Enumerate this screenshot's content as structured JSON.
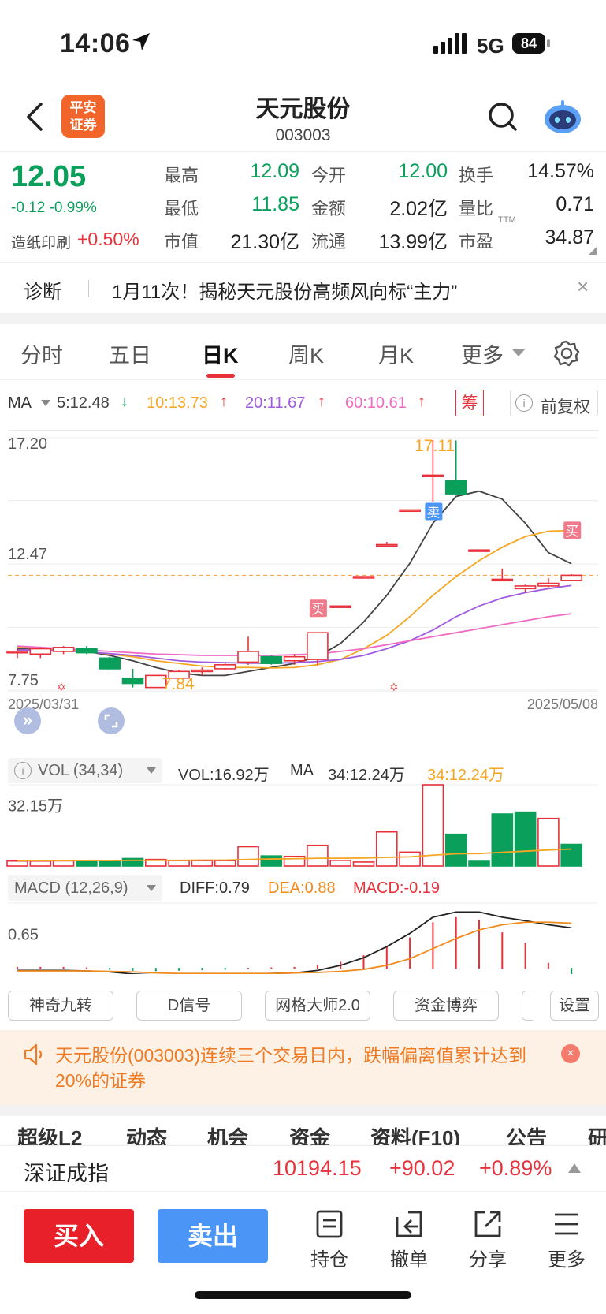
{
  "status": {
    "time": "14:06",
    "network": "5G",
    "battery": "84"
  },
  "header": {
    "broker_logo_line1": "平安",
    "broker_logo_line2": "证券",
    "stock_name": "天元股份",
    "stock_code": "003003"
  },
  "quote": {
    "price": "12.05",
    "change": "-0.12 -0.99%",
    "sector_name": "造纸印刷",
    "sector_change": "+0.50%",
    "fields": [
      {
        "label": "最高",
        "value": "12.09",
        "color": "green"
      },
      {
        "label": "今开",
        "value": "12.00",
        "color": "green"
      },
      {
        "label": "换手",
        "value": "14.57%",
        "color": "black"
      },
      {
        "label": "最低",
        "value": "11.85",
        "color": "green"
      },
      {
        "label": "金额",
        "value": "2.02亿",
        "color": "black"
      },
      {
        "label": "量比",
        "value": "0.71",
        "color": "black"
      },
      {
        "label": "市值",
        "value": "21.30亿",
        "color": "black"
      },
      {
        "label": "流通",
        "value": "13.99亿",
        "color": "black"
      },
      {
        "label": "市盈",
        "value": "34.87",
        "color": "black",
        "superscript": "TTM"
      }
    ]
  },
  "notice": {
    "label": "诊断",
    "text": "1月11次！揭秘天元股份高频风向标“主力”",
    "close": "×"
  },
  "tabs": [
    {
      "label": "分时",
      "active": false
    },
    {
      "label": "五日",
      "active": false
    },
    {
      "label": "日K",
      "active": true
    },
    {
      "label": "周K",
      "active": false
    },
    {
      "label": "月K",
      "active": false
    },
    {
      "label": "更多",
      "active": false
    }
  ],
  "ma_row": {
    "label": "MA",
    "ma5": "5:12.48",
    "ma10": "10:13.73",
    "ma20": "20:11.67",
    "ma60": "60:10.61",
    "chip_button": "筹",
    "adjust": "前复权",
    "colors": {
      "ma5": "#444444",
      "ma10": "#f5a623",
      "ma20": "#a05be0",
      "ma60": "#f06ac4"
    }
  },
  "chart_data": [
    {
      "type": "candlestick",
      "title": "",
      "y_labels": [
        "17.20",
        "12.47",
        "7.75"
      ],
      "ylim": [
        7.75,
        17.2
      ],
      "date_start": "2025/03/31",
      "date_end": "2025/05/08",
      "max_label": "17.11",
      "min_label": "7.84",
      "signals": [
        {
          "label": "买",
          "at": "candle 13"
        },
        {
          "label": "卖",
          "at": "candle 18"
        },
        {
          "label": "买",
          "at": "candle 24"
        }
      ],
      "candles": [
        {
          "o": 9.2,
          "h": 9.3,
          "l": 8.95,
          "c": 9.2
        },
        {
          "o": 9.1,
          "h": 9.35,
          "l": 8.95,
          "c": 9.3
        },
        {
          "o": 9.2,
          "h": 9.4,
          "l": 9.1,
          "c": 9.35
        },
        {
          "o": 9.3,
          "h": 9.4,
          "l": 9.1,
          "c": 9.15
        },
        {
          "o": 8.95,
          "h": 9.0,
          "l": 8.5,
          "c": 8.55
        },
        {
          "o": 8.2,
          "h": 8.55,
          "l": 7.85,
          "c": 8.0
        },
        {
          "o": 7.85,
          "h": 8.3,
          "l": 7.84,
          "c": 8.3
        },
        {
          "o": 8.2,
          "h": 8.5,
          "l": 8.2,
          "c": 8.45
        },
        {
          "o": 8.5,
          "h": 8.6,
          "l": 8.3,
          "c": 8.5
        },
        {
          "o": 8.55,
          "h": 8.75,
          "l": 8.5,
          "c": 8.7
        },
        {
          "o": 8.8,
          "h": 9.75,
          "l": 8.7,
          "c": 9.2
        },
        {
          "o": 9.0,
          "h": 9.05,
          "l": 8.7,
          "c": 8.75
        },
        {
          "o": 8.85,
          "h": 9.1,
          "l": 8.7,
          "c": 9.0
        },
        {
          "o": 8.9,
          "h": 9.9,
          "l": 8.7,
          "c": 9.9
        },
        {
          "o": 10.9,
          "h": 10.9,
          "l": 10.9,
          "c": 10.9
        },
        {
          "o": 12.0,
          "h": 12.0,
          "l": 12.0,
          "c": 12.0
        },
        {
          "o": 13.2,
          "h": 13.3,
          "l": 13.2,
          "c": 13.2
        },
        {
          "o": 14.5,
          "h": 14.5,
          "l": 14.5,
          "c": 14.5
        },
        {
          "o": 15.8,
          "h": 17.11,
          "l": 14.8,
          "c": 15.8
        },
        {
          "o": 15.6,
          "h": 17.1,
          "l": 15.3,
          "c": 15.1
        },
        {
          "o": 13.0,
          "h": 13.0,
          "l": 13.0,
          "c": 13.0
        },
        {
          "o": 11.9,
          "h": 12.3,
          "l": 11.9,
          "c": 11.9
        },
        {
          "o": 11.55,
          "h": 11.7,
          "l": 11.4,
          "c": 11.65
        },
        {
          "o": 11.65,
          "h": 11.95,
          "l": 11.6,
          "c": 11.75
        },
        {
          "o": 11.85,
          "h": 12.09,
          "l": 11.85,
          "c": 12.05
        }
      ],
      "ma_series": [
        {
          "name": "MA5",
          "values": [
            9.3,
            9.3,
            9.28,
            9.2,
            9.05,
            8.85,
            8.6,
            8.4,
            8.3,
            8.3,
            8.45,
            8.6,
            8.75,
            9.0,
            9.5,
            10.3,
            11.3,
            12.5,
            14.0,
            15.0,
            15.2,
            14.9,
            14.0,
            12.9,
            12.48
          ]
        },
        {
          "name": "MA10",
          "values": [
            9.35,
            9.32,
            9.28,
            9.2,
            9.1,
            9.0,
            8.85,
            8.75,
            8.65,
            8.6,
            8.6,
            8.58,
            8.6,
            8.7,
            8.9,
            9.3,
            9.8,
            10.5,
            11.3,
            12.0,
            12.6,
            13.1,
            13.5,
            13.7,
            13.73
          ]
        },
        {
          "name": "MA20",
          "values": [
            9.25,
            9.25,
            9.22,
            9.18,
            9.12,
            9.05,
            8.95,
            8.85,
            8.8,
            8.78,
            8.76,
            8.76,
            8.78,
            8.82,
            8.9,
            9.05,
            9.3,
            9.6,
            10.0,
            10.5,
            10.9,
            11.2,
            11.4,
            11.55,
            11.67
          ]
        },
        {
          "name": "MA60",
          "values": [
            9.4,
            9.35,
            9.3,
            9.25,
            9.2,
            9.15,
            9.1,
            9.08,
            9.05,
            9.05,
            9.05,
            9.05,
            9.08,
            9.1,
            9.2,
            9.3,
            9.45,
            9.6,
            9.75,
            9.9,
            10.05,
            10.2,
            10.35,
            10.5,
            10.61
          ]
        }
      ]
    },
    {
      "type": "bar",
      "title": "VOL",
      "y_labels": [
        "32.15万"
      ],
      "values": [
        2.1,
        2.1,
        2.2,
        2.2,
        2.4,
        3.2,
        2.8,
        2.3,
        2.3,
        2.3,
        8.2,
        4.3,
        4.1,
        8.8,
        2.4,
        1.7,
        14.5,
        5.9,
        34.5,
        13.5,
        2.0,
        22.1,
        22.9,
        20.2,
        9.2
      ],
      "up": [
        true,
        true,
        true,
        false,
        false,
        false,
        true,
        true,
        true,
        true,
        true,
        false,
        true,
        true,
        true,
        true,
        true,
        true,
        true,
        false,
        false,
        false,
        false,
        true,
        false
      ],
      "ma_values": [
        2.3,
        2.3,
        2.3,
        2.3,
        2.3,
        2.4,
        2.4,
        2.4,
        2.5,
        2.5,
        2.8,
        3.0,
        3.1,
        3.3,
        3.3,
        3.4,
        3.7,
        3.9,
        4.6,
        5.2,
        5.3,
        5.8,
        6.3,
        6.8,
        7.2
      ]
    },
    {
      "type": "bar",
      "title": "MACD",
      "y_labels": [
        "0.65"
      ],
      "values": [
        0.02,
        0.02,
        0.02,
        0.01,
        -0.02,
        -0.04,
        -0.05,
        -0.04,
        -0.03,
        -0.02,
        0.0,
        0.01,
        0.02,
        0.05,
        0.12,
        0.25,
        0.42,
        0.6,
        0.9,
        1.0,
        0.95,
        0.7,
        0.5,
        0.1,
        -0.19
      ],
      "dif": [
        -0.05,
        -0.05,
        -0.05,
        -0.06,
        -0.08,
        -0.12,
        -0.14,
        -0.14,
        -0.14,
        -0.14,
        -0.12,
        -0.11,
        -0.1,
        -0.05,
        0.05,
        0.2,
        0.42,
        0.68,
        1.0,
        1.1,
        1.1,
        1.0,
        0.93,
        0.85,
        0.79
      ],
      "dea": [
        -0.06,
        -0.06,
        -0.06,
        -0.06,
        -0.07,
        -0.08,
        -0.1,
        -0.11,
        -0.11,
        -0.11,
        -0.11,
        -0.11,
        -0.1,
        -0.09,
        -0.07,
        -0.03,
        0.05,
        0.18,
        0.38,
        0.58,
        0.75,
        0.85,
        0.9,
        0.9,
        0.88
      ],
      "ylim": [
        -0.2,
        1.2
      ]
    }
  ],
  "vol_row": {
    "label": "VOL (34,34)",
    "vol": "VOL:16.92万",
    "ma_label": "MA",
    "ma1": "34:12.24万",
    "ma2": "34:12.24万"
  },
  "macd_row": {
    "label": "MACD (12,26,9)",
    "diff": "DIFF:0.79",
    "dea": "DEA:0.88",
    "macd": "MACD:-0.19"
  },
  "tools": [
    "神奇九转",
    "D信号",
    "网格大师2.0",
    "资金博弈",
    "设置"
  ],
  "alert": {
    "text": "天元股份(003003)连续三个交易日内，跌幅偏离值累计达到20%的证券",
    "close": "×"
  },
  "sub_tabs": [
    "超级L2",
    "动态",
    "机会",
    "资金",
    "资料(F10)",
    "公告",
    "研"
  ],
  "index": {
    "name": "深证成指",
    "value": "10194.15",
    "change": "+90.02",
    "pct": "+0.89%"
  },
  "bottom": {
    "buy": "买入",
    "sell": "卖出",
    "actions": [
      "持仓",
      "撤单",
      "分享",
      "更多"
    ]
  }
}
